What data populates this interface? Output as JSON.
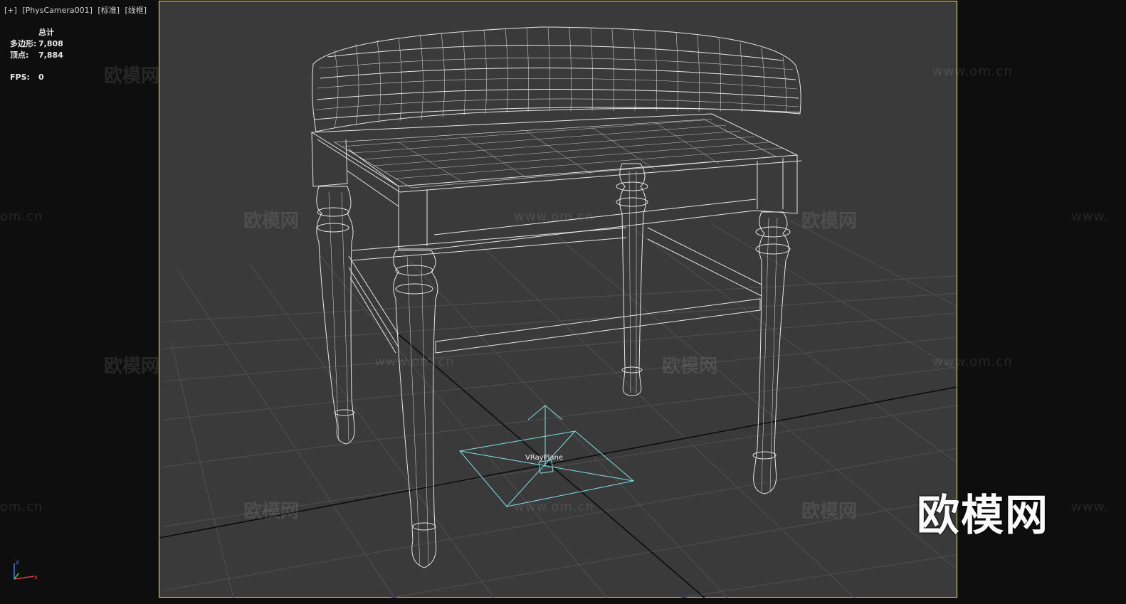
{
  "viewport": {
    "label_plus": "[+]",
    "label_camera": "[PhysCamera001]",
    "label_shading_std": "[标准]",
    "label_shading_mode": "[线框]"
  },
  "stats": {
    "header": "总计",
    "polygons_label": "多边形:",
    "polygons_value": "7,808",
    "vertices_label": "顶点:",
    "vertices_value": "7,884",
    "fps_label": "FPS:",
    "fps_value": "0"
  },
  "scene": {
    "object_label": "VRayPlane",
    "axis_x": "x",
    "axis_z": "z"
  },
  "colors": {
    "frame_border": "#e8e855",
    "viewport_bg": "#3a3a3a",
    "wire": "#e6e6e6",
    "vrayplane": "#7fe1e8",
    "grid": "#505050"
  },
  "watermarks": {
    "cn": "欧模网",
    "en": "www.om.cn",
    "en_partial_left": "om.cn",
    "en_partial_right": "www.",
    "brand": "欧模网"
  }
}
